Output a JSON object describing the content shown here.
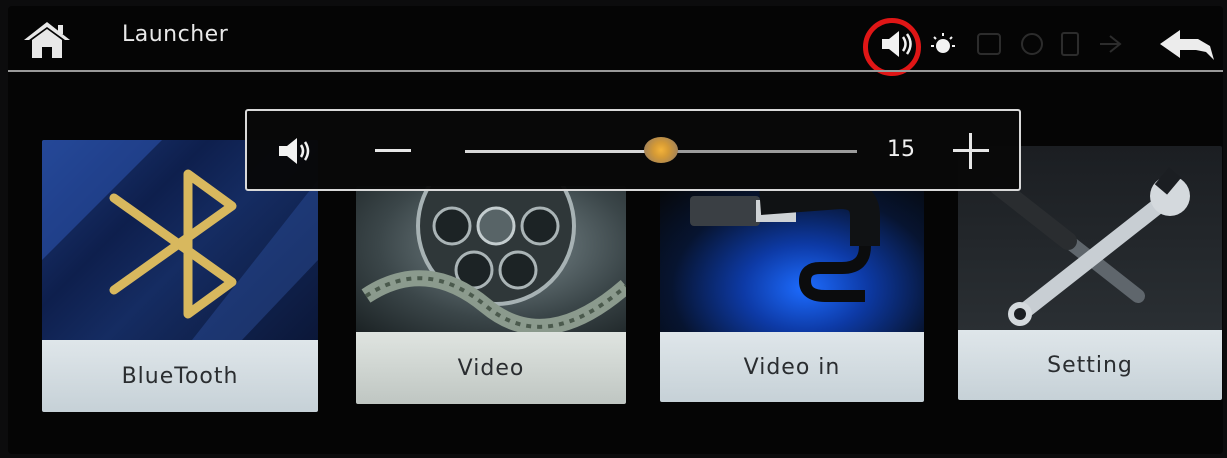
{
  "topbar": {
    "title": "Launcher",
    "icons": [
      "home-icon",
      "speaker-icon",
      "brightness-icon",
      "back-arrow-icon"
    ]
  },
  "volume_popup": {
    "value": "15",
    "level_fraction": 0.5,
    "icons": [
      "speaker-icon",
      "minus-icon",
      "plus-icon"
    ]
  },
  "tiles": [
    {
      "label": "BlueTooth",
      "icon": "bluetooth-icon"
    },
    {
      "label": "Video",
      "icon": "film-reel-icon"
    },
    {
      "label": "Video in",
      "icon": "video-cable-icon"
    },
    {
      "label": "Setting",
      "icon": "wrench-screwdriver-icon"
    }
  ],
  "colors": {
    "accent_ring": "#e01616",
    "slider_thumb": "#e2a53a",
    "bluetooth_symbol": "#d8b85e",
    "background": "#050505"
  }
}
